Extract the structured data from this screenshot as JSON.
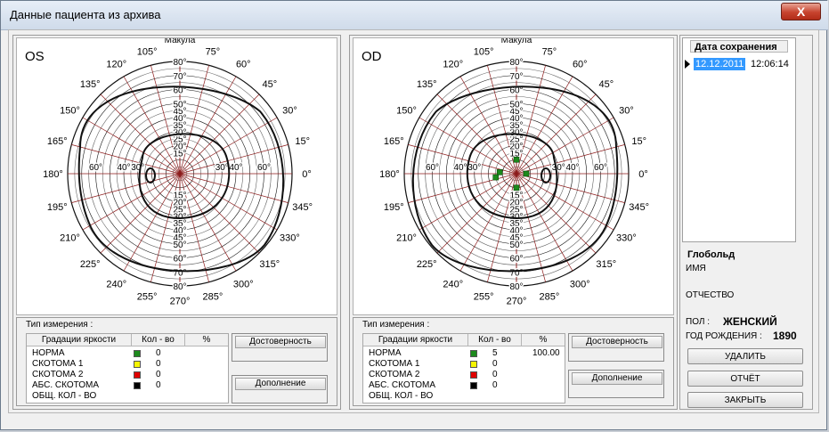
{
  "window": {
    "title": "Данные пациента из архива",
    "close_label": "X"
  },
  "polar": {
    "makula_label": "Макула",
    "angle_labels": [
      {
        "deg": 0,
        "text": "0°"
      },
      {
        "deg": 15,
        "text": "15°"
      },
      {
        "deg": 30,
        "text": "30°"
      },
      {
        "deg": 45,
        "text": "45°"
      },
      {
        "deg": 60,
        "text": "60°"
      },
      {
        "deg": 75,
        "text": "75°"
      },
      {
        "deg": 105,
        "text": "105°"
      },
      {
        "deg": 120,
        "text": "120°"
      },
      {
        "deg": 135,
        "text": "135°"
      },
      {
        "deg": 150,
        "text": "150°"
      },
      {
        "deg": 165,
        "text": "165°"
      },
      {
        "deg": 180,
        "text": "180°"
      },
      {
        "deg": 195,
        "text": "195°"
      },
      {
        "deg": 210,
        "text": "210°"
      },
      {
        "deg": 225,
        "text": "225°"
      },
      {
        "deg": 240,
        "text": "240°"
      },
      {
        "deg": 255,
        "text": "255°"
      },
      {
        "deg": 270,
        "text": "270°"
      },
      {
        "deg": 285,
        "text": "285°"
      },
      {
        "deg": 300,
        "text": "300°"
      },
      {
        "deg": 315,
        "text": "315°"
      },
      {
        "deg": 330,
        "text": "330°"
      },
      {
        "deg": 345,
        "text": "345°"
      }
    ],
    "vertical_tick_labels": [
      "15°",
      "20°",
      "25°",
      "30°",
      "35°",
      "40°",
      "45°",
      "50°",
      "60°",
      "70°",
      "80°"
    ],
    "vertical_tick_values": [
      15,
      20,
      25,
      30,
      35,
      40,
      45,
      50,
      60,
      70,
      80
    ],
    "horizontal_tick_labels": [
      "30°",
      "40°",
      "60°"
    ],
    "horizontal_tick_values": [
      30,
      40,
      60
    ],
    "max_degree": 80
  },
  "os": {
    "eye_label": "OS",
    "measure_title": "Тип измерения :",
    "legend_headers": {
      "grade": "Градации яркости",
      "count": "Кол - во",
      "pct": "%"
    },
    "rows": [
      {
        "name": "НОРМА",
        "color": "#1d8a1d",
        "count": "0",
        "pct": ""
      },
      {
        "name": "СКОТОМА 1",
        "color": "#f5f500",
        "count": "0",
        "pct": ""
      },
      {
        "name": "СКОТОМА 2",
        "color": "#e00000",
        "count": "0",
        "pct": ""
      },
      {
        "name": "АБС. СКОТОМА",
        "color": "#000000",
        "count": "0",
        "pct": ""
      }
    ],
    "total_label": "ОБЩ. КОЛ - ВО",
    "reliability_label": "Достоверность",
    "addition_label": "Дополнение",
    "points": []
  },
  "od": {
    "eye_label": "OD",
    "measure_title": "Тип измерения :",
    "legend_headers": {
      "grade": "Градации яркости",
      "count": "Кол - во",
      "pct": "%"
    },
    "rows": [
      {
        "name": "НОРМА",
        "color": "#1d8a1d",
        "count": "5",
        "pct": "100.00"
      },
      {
        "name": "СКОТОМА 1",
        "color": "#f5f500",
        "count": "0",
        "pct": ""
      },
      {
        "name": "СКОТОМА 2",
        "color": "#e00000",
        "count": "0",
        "pct": ""
      },
      {
        "name": "АБС. СКОТОМА",
        "color": "#000000",
        "count": "0",
        "pct": ""
      }
    ],
    "total_label": "ОБЩ. КОЛ - ВО",
    "reliability_label": "Достоверность",
    "addition_label": "Дополнение",
    "points": [
      {
        "deg": 90,
        "r": 10,
        "grade": "НОРМА"
      },
      {
        "deg": 0,
        "r": 7,
        "grade": "НОРМА"
      },
      {
        "deg": 270,
        "r": 10,
        "grade": "НОРМА"
      },
      {
        "deg": 175,
        "r": 12,
        "grade": "НОРМА"
      },
      {
        "deg": 190,
        "r": 15,
        "grade": "НОРМА"
      }
    ]
  },
  "archive": {
    "header": "Дата сохранения",
    "date": "12.12.2011",
    "time": "12:06:14"
  },
  "patient": {
    "surname": "Глобольд",
    "name_label": "ИМЯ",
    "patronymic_label": "ОТЧЕСТВО",
    "sex_label": "ПОЛ :",
    "sex_value": "ЖЕНСКИЙ",
    "birth_label": "ГОД РОЖДЕНИЯ :",
    "birth_value": "1890"
  },
  "buttons": {
    "delete": "УДАЛИТЬ",
    "report": "ОТЧЁТ",
    "close": "ЗАКРЫТЬ"
  }
}
